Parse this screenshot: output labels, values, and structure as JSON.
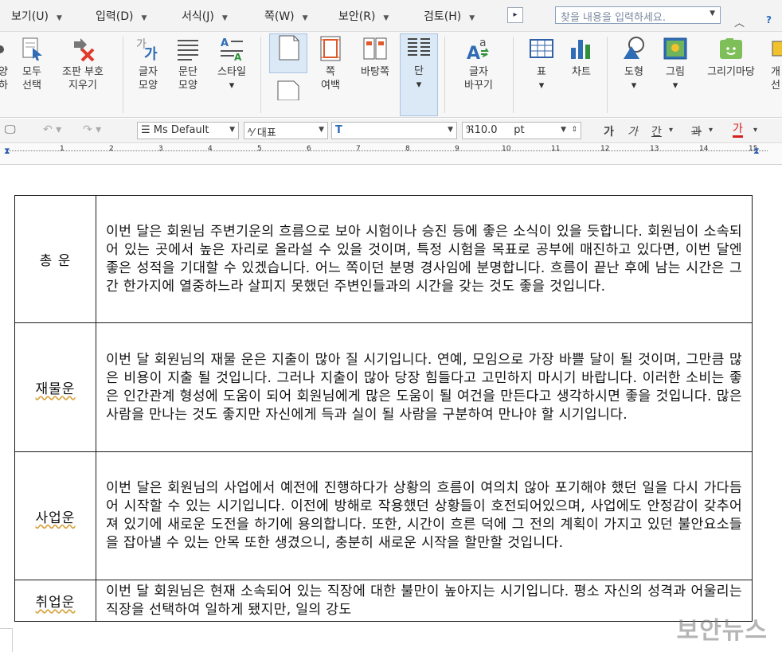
{
  "menu": {
    "items": [
      "보기(U)",
      "입력(D)",
      "서식(J)",
      "쪽(W)",
      "보안(R)",
      "검토(H)"
    ],
    "search_placeholder": "찾을 내용을 입력하세요.",
    "minimize": "︿",
    "help": "?"
  },
  "ribbon": {
    "buttons": [
      {
        "label": "양\n하",
        "icon": "partial-icon"
      },
      {
        "label": "모두\n선택",
        "icon": "select-all-icon"
      },
      {
        "label": "조판 부호\n지우기",
        "icon": "clear-format-icon"
      },
      {
        "label": "글자\n모양",
        "icon": "char-shape-icon"
      },
      {
        "label": "문단\n모양",
        "icon": "paragraph-shape-icon"
      },
      {
        "label": "스타일",
        "icon": "style-icon"
      },
      {
        "label": "",
        "icon": "page-icon"
      },
      {
        "label": "쪽\n여백",
        "icon": "page-margin-icon"
      },
      {
        "label": "바탕쪽",
        "icon": "master-page-icon"
      },
      {
        "label": "단",
        "icon": "columns-icon"
      },
      {
        "label": "글자\n바꾸기",
        "icon": "change-char-icon"
      },
      {
        "label": "표",
        "icon": "table-icon"
      },
      {
        "label": "차트",
        "icon": "chart-icon"
      },
      {
        "label": "도형",
        "icon": "shape-icon"
      },
      {
        "label": "그림",
        "icon": "picture-icon"
      },
      {
        "label": "그리기마당",
        "icon": "drawing-icon"
      },
      {
        "label": "개\n선",
        "icon": "partial-icon"
      }
    ]
  },
  "format": {
    "style": "Ms Default",
    "lang": "대표",
    "font": "",
    "size": "10.0",
    "unit": "pt",
    "bold": "가",
    "italic": "가",
    "underline": "간",
    "strike": "과",
    "color": "가"
  },
  "ruler": {
    "numbers": [
      "1",
      "2",
      "3",
      "4",
      "5",
      "6",
      "7",
      "8",
      "9",
      "10",
      "11",
      "12",
      "13",
      "14",
      "15"
    ]
  },
  "table": {
    "rows": [
      {
        "category": "총 운",
        "text": "이번 달은 회원님 주변기운의 흐름으로 보아 시험이나 승진 등에 좋은 소식이 있을 듯합니다. 회원님이 소속되어 있는 곳에서 높은 자리로 올라설 수 있을 것이며, 특정 시험을 목표로 공부에 매진하고 있다면, 이번 달엔 좋은 성적을 기대할 수 있겠습니다. 어느 쪽이던 분명 경사임에 분명합니다. 흐름이 끝난 후에 남는 시간은 그간 한가지에 열중하느라 살피지 못했던 주변인들과의 시간을 갖는 것도 좋을 것입니다."
      },
      {
        "category": "재물운",
        "text": "이번 달 회원님의 재물 운은 지출이 많아 질 시기입니다. 연예, 모임으로 가장 바쁠 달이 될 것이며, 그만큼 많은 비용이 지출 될 것입니다. 그러나 지출이 많아 당장 힘들다고 고민하지 마시기 바랍니다. 이러한 소비는 좋은 인간관계 형성에 도움이 되어 회원님에게 많은 도움이 될 여건을 만든다고 생각하시면 좋을 것입니다. 많은 사람을 만나는 것도 좋지만 자신에게 득과 실이 될 사람을 구분하여 만나야 할 시기입니다."
      },
      {
        "category": "사업운",
        "text": "이번 달은 회원님의 사업에서 예전에 진행하다가 상황의 흐름이 여의치 않아 포기해야 했던 일을 다시 가다듬어 시작할 수 있는 시기입니다. 이전에 방해로 작용했던 상황들이 호전되어있으며, 사업에도 안정감이 갖추어져 있기에 새로운 도전을 하기에 용의합니다. 또한, 시간이 흐른 덕에 그 전의 계획이 가지고 있던 불안요소들을 잡아낼 수 있는 안목 또한 생겼으니, 충분히 새로운 시작을 할만할 것입니다."
      },
      {
        "category": "취업운",
        "text": "이번 달 회원님은 현재 소속되어 있는 직장에 대한 불만이 높아지는 시기입니다. 평소 자신의 성격과 어울리는 직장을 선택하여 일하게 됐지만, 일의 강도"
      }
    ]
  },
  "watermark": "보안뉴스"
}
